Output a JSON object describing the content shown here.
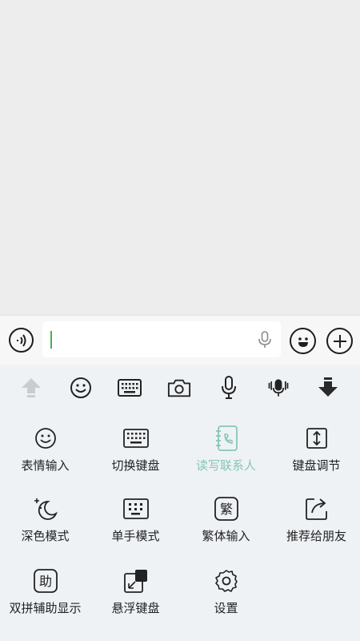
{
  "input": {
    "text": "",
    "voice_toggle_icon": "voice-toggle-icon",
    "mic_icon": "mic-icon",
    "emoji_icon": "emoji-icon",
    "plus_icon": "plus-icon"
  },
  "toolbar": {
    "items": [
      "upload-arrow-icon",
      "emoji-icon",
      "keyboard-icon",
      "camera-icon",
      "microphone-icon",
      "podcast-mic-icon",
      "collapse-keyboard-icon"
    ]
  },
  "panel": {
    "items": [
      {
        "label": "表情输入",
        "icon": "emoji-icon"
      },
      {
        "label": "切换键盘",
        "icon": "keyboard-icon"
      },
      {
        "label": "读写联系人",
        "icon": "contacts-book-icon",
        "active": true
      },
      {
        "label": "键盘调节",
        "icon": "resize-icon"
      },
      {
        "label": "深色模式",
        "icon": "moon-icon"
      },
      {
        "label": "单手模式",
        "icon": "one-hand-keyboard-icon"
      },
      {
        "label": "繁体输入",
        "icon": "traditional-chinese-icon",
        "glyph": "繁"
      },
      {
        "label": "推荐给朋友",
        "icon": "share-icon"
      },
      {
        "label": "双拼辅助显示",
        "icon": "shuangpin-helper-icon",
        "glyph": "助"
      },
      {
        "label": "悬浮键盘",
        "icon": "floating-keyboard-icon"
      },
      {
        "label": "设置",
        "icon": "gear-icon"
      }
    ]
  },
  "colors": {
    "accent_green": "#4caf50",
    "active_label": "#86c7b3",
    "keyboard_bg": "#eff2f5"
  }
}
